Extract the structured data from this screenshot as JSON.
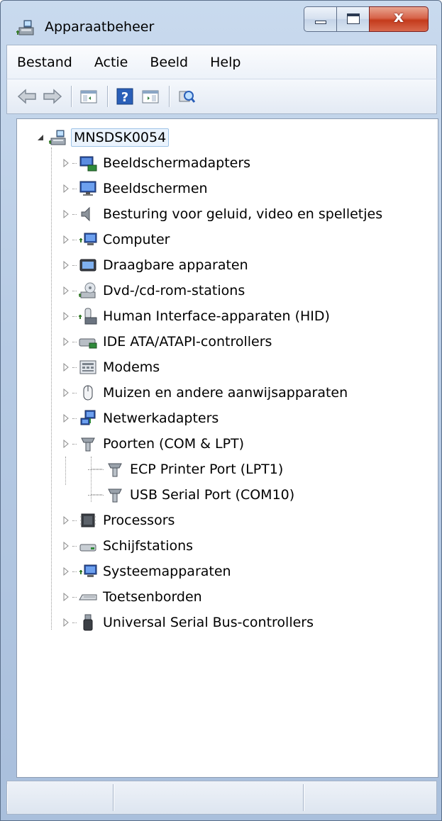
{
  "window": {
    "title": "Apparaatbeheer",
    "close_glyph": "x"
  },
  "menu": [
    "Bestand",
    "Actie",
    "Beeld",
    "Help"
  ],
  "toolbar": {
    "buttons": [
      "back-arrow-icon",
      "forward-arrow-icon",
      "show-hide-console-tree-icon",
      "help-icon",
      "properties-icon",
      "scan-hardware-icon"
    ]
  },
  "tree": {
    "root": {
      "label": "MNSDSK0054",
      "icon": "computer-network-icon",
      "expanded": true
    },
    "categories": [
      {
        "label": "Beeldschermadapters",
        "icon": "display-adapter-icon",
        "expanded": false
      },
      {
        "label": "Beeldschermen",
        "icon": "monitor-icon",
        "expanded": false
      },
      {
        "label": "Besturing voor geluid, video en spelletjes",
        "icon": "speaker-icon",
        "expanded": false
      },
      {
        "label": "Computer",
        "icon": "computer-icon",
        "expanded": false
      },
      {
        "label": "Draagbare apparaten",
        "icon": "portable-device-icon",
        "expanded": false
      },
      {
        "label": "Dvd-/cd-rom-stations",
        "icon": "optical-drive-icon",
        "expanded": false
      },
      {
        "label": "Human Interface-apparaten (HID)",
        "icon": "hid-icon",
        "expanded": false
      },
      {
        "label": "IDE ATA/ATAPI-controllers",
        "icon": "ide-controller-icon",
        "expanded": false
      },
      {
        "label": "Modems",
        "icon": "modem-icon",
        "expanded": false
      },
      {
        "label": "Muizen en andere aanwijsapparaten",
        "icon": "mouse-icon",
        "expanded": false
      },
      {
        "label": "Netwerkadapters",
        "icon": "network-adapter-icon",
        "expanded": false
      },
      {
        "label": "Poorten (COM & LPT)",
        "icon": "port-icon",
        "expanded": true,
        "children": [
          {
            "label": "ECP Printer Port (LPT1)",
            "icon": "port-icon"
          },
          {
            "label": "USB Serial Port (COM10)",
            "icon": "port-icon"
          }
        ]
      },
      {
        "label": "Processors",
        "icon": "processor-icon",
        "expanded": false
      },
      {
        "label": "Schijfstations",
        "icon": "disk-drive-icon",
        "expanded": false
      },
      {
        "label": "Systeemapparaten",
        "icon": "system-device-icon",
        "expanded": false
      },
      {
        "label": "Toetsenborden",
        "icon": "keyboard-icon",
        "expanded": false
      },
      {
        "label": "Universal Serial Bus-controllers",
        "icon": "usb-icon",
        "expanded": false
      }
    ]
  },
  "statusbar": {
    "panes": [
      "",
      "",
      ""
    ]
  }
}
